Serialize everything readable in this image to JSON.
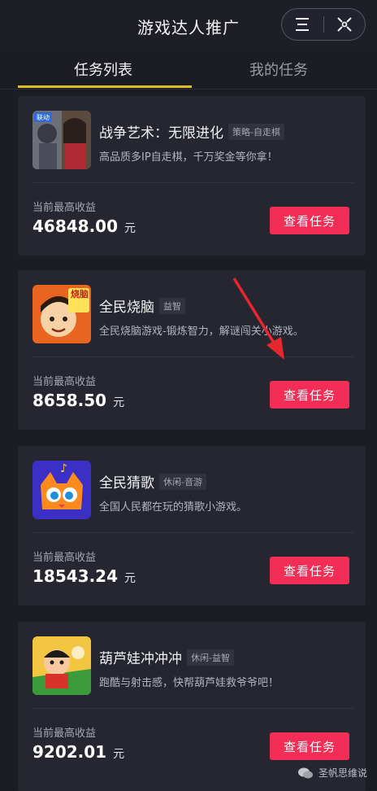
{
  "header": {
    "title": "游戏达人推广",
    "menu_icon": "menu-icon",
    "close_icon": "close-icon"
  },
  "tabs": [
    {
      "label": "任务列表",
      "active": true
    },
    {
      "label": "我的任务",
      "active": false
    }
  ],
  "tasks": [
    {
      "name": "战争艺术：无限进化",
      "tag": "策略-自走棋",
      "description": "高品质多IP自走棋，千万奖金等你拿！",
      "earnings_label": "当前最高收益",
      "earnings_value": "46848.00",
      "earnings_unit": "元",
      "button_label": "查看任务"
    },
    {
      "name": "全民烧脑",
      "tag": "益智",
      "description": "全民烧脑游戏-锻炼智力，解谜闯关小游戏。",
      "earnings_label": "当前最高收益",
      "earnings_value": "8658.50",
      "earnings_unit": "元",
      "button_label": "查看任务",
      "icon_text": "烧脑"
    },
    {
      "name": "全民猜歌",
      "tag": "休闲-音游",
      "description": "全国人民都在玩的猜歌小游戏。",
      "earnings_label": "当前最高收益",
      "earnings_value": "18543.24",
      "earnings_unit": "元",
      "button_label": "查看任务"
    },
    {
      "name": "葫芦娃冲冲冲",
      "tag": "休闲-益智",
      "description": "跑酷与射击感，快帮葫芦娃救爷爷吧！",
      "earnings_label": "当前最高收益",
      "earnings_value": "9202.01",
      "earnings_unit": "元",
      "button_label": "查看任务"
    }
  ],
  "watermark": "圣帆思维说",
  "colors": {
    "accent": "#f32e56",
    "tab_underline": "#e0bf25",
    "background": "#1c1c24",
    "card": "#262631"
  }
}
